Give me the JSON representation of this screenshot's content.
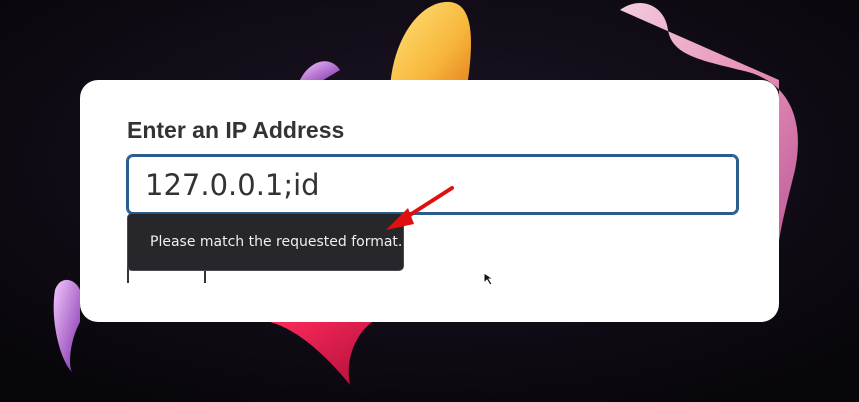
{
  "form": {
    "label": "Enter an IP Address",
    "input_value": "127.0.0.1;id"
  },
  "tooltip": {
    "message": "Please match the requested format."
  },
  "colors": {
    "input_border": "#2b5d8c",
    "tooltip_bg": "#26262b",
    "annotation_arrow": "#e01010"
  },
  "icons": {
    "annotation": "red-arrow-icon",
    "pointer": "mouse-cursor-icon"
  }
}
